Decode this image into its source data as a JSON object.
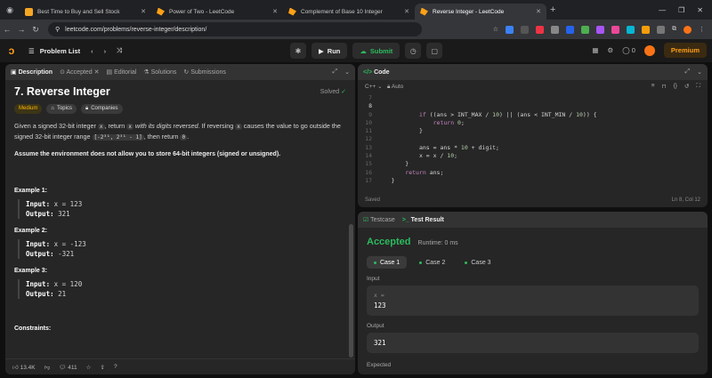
{
  "browser": {
    "tabs": [
      {
        "title": "Best Time to Buy and Sell Stock"
      },
      {
        "title": "Power of Two - LeetCode"
      },
      {
        "title": "Complement of Base 10 Integer"
      },
      {
        "title": "Reverse Integer - LeetCode"
      }
    ],
    "url": "leetcode.com/problems/reverse-integer/description/"
  },
  "header": {
    "problem_list": "Problem List",
    "run": "Run",
    "submit": "Submit",
    "coins": "0",
    "premium": "Premium"
  },
  "left_tabs": [
    "Description",
    "Accepted",
    "Editorial",
    "Solutions",
    "Submissions"
  ],
  "problem": {
    "title": "7. Reverse Integer",
    "status": "Solved",
    "difficulty": "Medium",
    "chip_topics": "Topics",
    "chip_companies": "Companies",
    "p1_a": "Given a signed 32-bit integer ",
    "p1_x": "x",
    "p1_b": ", return ",
    "p1_x2": "x",
    "p1_c": " with its digits reversed",
    "p1_d": ". If reversing ",
    "p1_x3": "x",
    "p1_e": " causes the value to go outside the signed 32-bit integer range ",
    "p1_range": "[-2³¹, 2³¹ - 1]",
    "p1_f": ", then return ",
    "p1_zero": "0",
    "p1_g": ".",
    "p2": "Assume the environment does not allow you to store 64-bit integers (signed or unsigned).",
    "examples": [
      {
        "title": "Example 1:",
        "input": "x = 123",
        "output": "321"
      },
      {
        "title": "Example 2:",
        "input": "x = -123",
        "output": "-321"
      },
      {
        "title": "Example 3:",
        "input": "x = 120",
        "output": "21"
      }
    ],
    "input_label": "Input:",
    "output_label": "Output:",
    "constraints": "Constraints:"
  },
  "desc_footer": {
    "likes": "13.4K",
    "comments": "411"
  },
  "code_panel": {
    "title": "Code",
    "lang": "C++",
    "mode": "Auto",
    "saved": "Saved",
    "cursor": "Ln 8, Col 12",
    "lines": [
      {
        "n": "7",
        "t": ""
      },
      {
        "n": "8",
        "t": ""
      },
      {
        "n": "9",
        "t": "            if ((ans > INT_MAX / 10) || (ans < INT_MIN / 10)) {"
      },
      {
        "n": "10",
        "t": "                return 0;"
      },
      {
        "n": "11",
        "t": "            }"
      },
      {
        "n": "12",
        "t": ""
      },
      {
        "n": "13",
        "t": "            ans = ans * 10 + digit;"
      },
      {
        "n": "14",
        "t": "            x = x / 10;"
      },
      {
        "n": "15",
        "t": "        }"
      },
      {
        "n": "16",
        "t": "        return ans;"
      },
      {
        "n": "17",
        "t": "    }"
      }
    ]
  },
  "result_panel": {
    "tab_testcase": "Testcase",
    "tab_result": "Test Result",
    "status": "Accepted",
    "runtime": "Runtime: 0 ms",
    "cases": [
      "Case 1",
      "Case 2",
      "Case 3"
    ],
    "input_label": "Input",
    "input_key": "x =",
    "input_value": "123",
    "output_label": "Output",
    "output_value": "321",
    "expected_label": "Expected"
  }
}
